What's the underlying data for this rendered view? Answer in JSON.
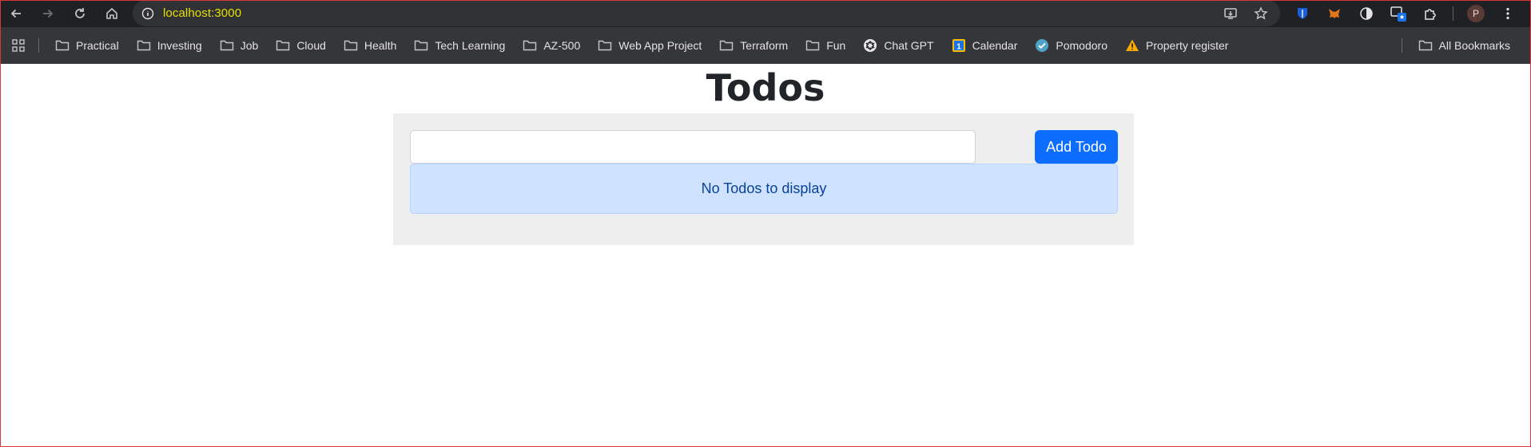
{
  "browser": {
    "url": "localhost:3000",
    "nav_icons": [
      "back-icon",
      "forward-icon",
      "reload-icon",
      "home-icon"
    ],
    "omnibox_icons": [
      "install-icon",
      "bookmark-star-icon"
    ],
    "extension_icons": [
      "bitwarden-icon",
      "metamask-icon",
      "dark-reader-icon",
      "tab-manager-icon",
      "extensions-puzzle-icon"
    ],
    "profile_initial": "P",
    "colors": {
      "toolbar": "#202124",
      "omnibox": "#303134",
      "url_text": "#e8e000",
      "bookmarks_bar": "#35363a"
    }
  },
  "bookmarks": {
    "items": [
      {
        "label": "Practical",
        "icon": "folder-icon"
      },
      {
        "label": "Investing",
        "icon": "folder-icon"
      },
      {
        "label": "Job",
        "icon": "folder-icon"
      },
      {
        "label": "Cloud",
        "icon": "folder-icon"
      },
      {
        "label": "Health",
        "icon": "folder-icon"
      },
      {
        "label": "Tech Learning",
        "icon": "folder-icon"
      },
      {
        "label": "AZ-500",
        "icon": "folder-icon"
      },
      {
        "label": "Web App Project",
        "icon": "folder-icon"
      },
      {
        "label": "Terraform",
        "icon": "folder-icon"
      },
      {
        "label": "Fun",
        "icon": "folder-icon"
      },
      {
        "label": "Chat GPT",
        "icon": "chatgpt-icon"
      },
      {
        "label": "Calendar",
        "icon": "calendar-icon"
      },
      {
        "label": "Pomodoro",
        "icon": "check-circle-icon"
      },
      {
        "label": "Property register",
        "icon": "warning-icon"
      }
    ],
    "all_bookmarks_label": "All Bookmarks"
  },
  "page": {
    "title": "Todos",
    "input": {
      "value": "",
      "placeholder": ""
    },
    "add_button_label": "Add Todo",
    "empty_message": "No Todos to display",
    "colors": {
      "panel": "#eeeeee",
      "button": "#0d6efd",
      "alert_bg": "#cfe2ff",
      "alert_text": "#084298"
    }
  }
}
